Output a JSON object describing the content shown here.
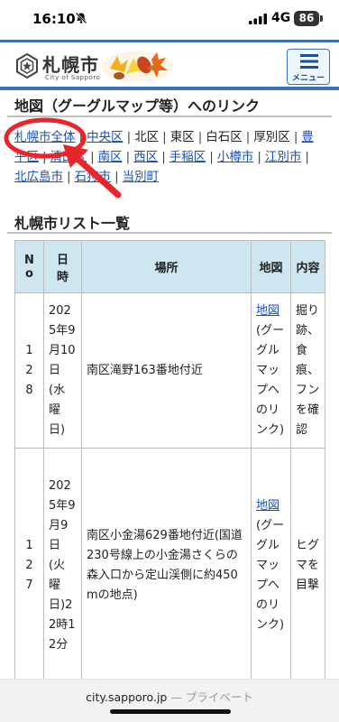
{
  "status_bar": {
    "time": "16:10",
    "network": "4G",
    "battery": "86"
  },
  "header": {
    "logo_text": "札幌市",
    "logo_subtext": "City of Sapporo",
    "menu_label": "メニュー"
  },
  "links_section": {
    "title": "地図（グーグルマップ等）へのリンク",
    "line1": [
      {
        "label": "札幌市全体",
        "link": true
      },
      {
        "label": "中央区",
        "link": true
      },
      {
        "label": "北区",
        "link": false
      },
      {
        "label": "東区",
        "link": false
      },
      {
        "label": "白石区",
        "link": false
      },
      {
        "label": "厚別区",
        "link": false
      },
      {
        "label": "豊",
        "link": true
      }
    ],
    "line2": [
      {
        "label": "平区",
        "link": true
      },
      {
        "label": "清田区",
        "link": true
      },
      {
        "label": "南区",
        "link": true
      },
      {
        "label": "西区",
        "link": true
      },
      {
        "label": "手稲区",
        "link": true
      },
      {
        "label": "小樽市",
        "link": true
      },
      {
        "label": "江別市",
        "link": true
      }
    ],
    "line3": [
      {
        "label": "北広島市",
        "link": true
      },
      {
        "label": "石狩市",
        "link": true
      },
      {
        "label": "当別町",
        "link": true
      }
    ]
  },
  "list_section": {
    "title": "札幌市リスト一覧",
    "headers": {
      "no": "No",
      "date": "日時",
      "place": "場所",
      "map": "地図",
      "content": "内容"
    },
    "rows": [
      {
        "no": "128",
        "date": "2025年9月10日(水曜日)",
        "place": "南区滝野163番地付近",
        "map_link": "地図",
        "map_note": "(グーグルマップへのリンク)",
        "content": "掘り跡、食痕、フンを確認"
      },
      {
        "no": "127",
        "date": "2025年9月9日(火曜日)22時12分",
        "place": "南区小金湯629番地付近(国道230号線上の小金湯さくらの森入口から定山渓側に約450mの地点)",
        "map_link": "地図",
        "map_note": "(グーグルマップへのリンク)",
        "content": "ヒグマを目撃"
      }
    ]
  },
  "url_bar": {
    "domain": "city.sapporo.jp",
    "separator": "—",
    "privacy": "プライベート"
  },
  "colors": {
    "accent": "#3a6fb5",
    "link": "#1a52b8",
    "table_header": "#cde6f0",
    "annotation": "#e8252b"
  },
  "icons": [
    "bell-off-icon",
    "signal-icon",
    "battery-icon",
    "sapporo-emblem-icon",
    "autumn-leaves-icon",
    "hamburger-menu-icon"
  ]
}
